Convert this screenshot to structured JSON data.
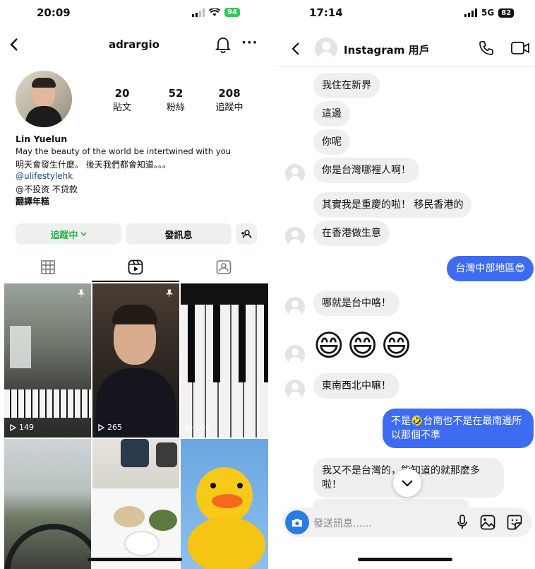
{
  "left": {
    "status": {
      "time": "20:09",
      "battery": "94"
    },
    "header": {
      "username": "adrargio"
    },
    "stats": [
      {
        "value": "20",
        "label": "貼文"
      },
      {
        "value": "52",
        "label": "粉絲"
      },
      {
        "value": "208",
        "label": "追蹤中"
      }
    ],
    "bio": {
      "name": "Lin  Yuelun",
      "line1": "May the beauty of the world be intertwined with you",
      "line2": "明天會發生什麼。    後天我們都會知道。。。",
      "link": "@ulifestylehk",
      "line4": "@不投资 不贷款",
      "translate": "翻譯年糕"
    },
    "buttons": {
      "following": "追蹤中",
      "message": "發訊息"
    },
    "reels": [
      {
        "views": "149"
      },
      {
        "views": "265"
      },
      {
        "views": "108"
      }
    ],
    "colors": {
      "accent": "#2ab04a",
      "link": "#1a4a8a"
    }
  },
  "right": {
    "status": {
      "time": "17:14",
      "network": "5G",
      "battery": "82"
    },
    "header": {
      "title": "Instagram 用戶"
    },
    "messages": [
      {
        "text": "我住在新界"
      },
      {
        "text": "這邊"
      },
      {
        "text": "你呢"
      },
      {
        "text": "你是台灣哪裡人啊！"
      },
      {
        "text": "其實我是重慶的啦！ 移民香港的"
      },
      {
        "text": "在香港做生意"
      },
      {
        "text": "台灣中部地區😎"
      },
      {
        "text": "哪就是台中咯！"
      },
      {
        "text": "😄😄😄"
      },
      {
        "text": "東南西北中嘛！"
      },
      {
        "text": "不是🤣台南也不是在最南邊所以那個不準"
      },
      {
        "text": "我又不是台灣的，能知道的就那麼多啦！"
      }
    ],
    "composer": {
      "placeholder": "發送訊息......"
    },
    "colors": {
      "bubble_out": "#3d6bf2",
      "bubble_in": "#efefef"
    }
  }
}
